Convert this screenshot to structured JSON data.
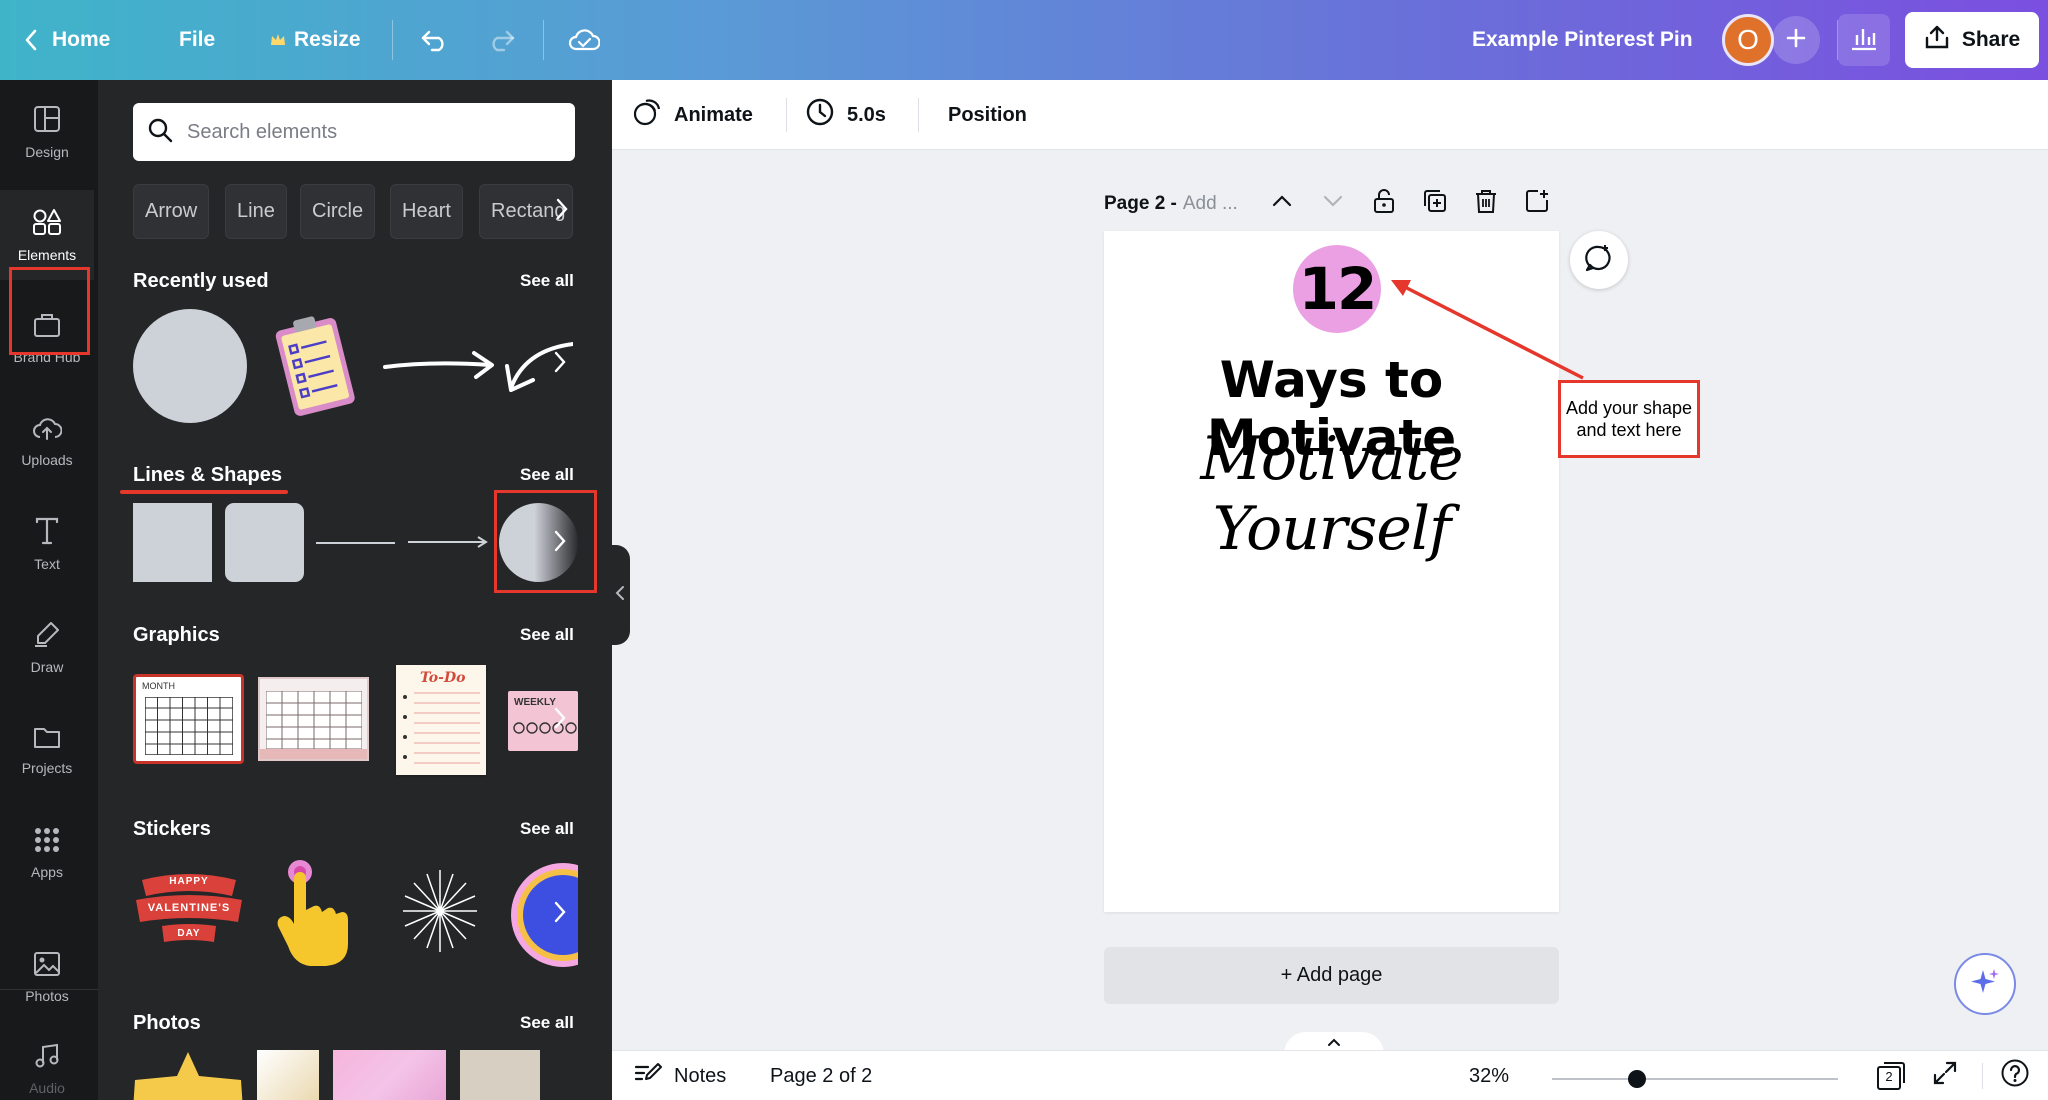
{
  "topbar": {
    "home_label": "Home",
    "file_label": "File",
    "resize_label": "Resize",
    "design_title": "Example Pinterest Pin",
    "avatar_initial": "O",
    "share_label": "Share"
  },
  "rail": {
    "items": [
      {
        "label": "Design",
        "icon": "layout-icon"
      },
      {
        "label": "Elements",
        "icon": "shapes-icon"
      },
      {
        "label": "Brand Hub",
        "icon": "briefcase-icon"
      },
      {
        "label": "Uploads",
        "icon": "cloud-upload-icon"
      },
      {
        "label": "Text",
        "icon": "text-icon"
      },
      {
        "label": "Draw",
        "icon": "pen-icon"
      },
      {
        "label": "Projects",
        "icon": "folder-icon"
      },
      {
        "label": "Apps",
        "icon": "grid-icon"
      },
      {
        "label": "Photos",
        "icon": "image-icon"
      },
      {
        "label": "Audio",
        "icon": "music-icon"
      }
    ],
    "active": "Elements"
  },
  "panel": {
    "search_placeholder": "Search elements",
    "chips": [
      "Arrow",
      "Line",
      "Circle",
      "Heart",
      "Rectang"
    ],
    "see_all": "See all",
    "sections": {
      "recently_used": "Recently used",
      "lines_shapes": "Lines & Shapes",
      "graphics": "Graphics",
      "stickers": "Stickers",
      "photos": "Photos"
    },
    "graphic_texts": {
      "month": "MONTH",
      "todo": "To-Do",
      "weekly": "WEEKLY"
    },
    "sticker_texts": {
      "line1": "HAPPY",
      "line2": "VALENTINE'S",
      "line3": "DAY"
    }
  },
  "context_toolbar": {
    "animate_label": "Animate",
    "duration_label": "5.0s",
    "position_label": "Position"
  },
  "canvas": {
    "page_label": "Page 2 -",
    "page_title_placeholder": "Add ...",
    "number": "12",
    "headline": "Ways to Motivate",
    "script_line": "Motivate Yourself",
    "note": "Add your shape and text here",
    "add_page_label": "+ Add page"
  },
  "bottombar": {
    "notes_label": "Notes",
    "page_indicator": "Page 2 of 2",
    "zoom": "32%",
    "page_count": "2"
  },
  "colors": {
    "accent_red": "#e5372c",
    "number_circle": "#eba0e4",
    "avatar": "#e0712b"
  }
}
